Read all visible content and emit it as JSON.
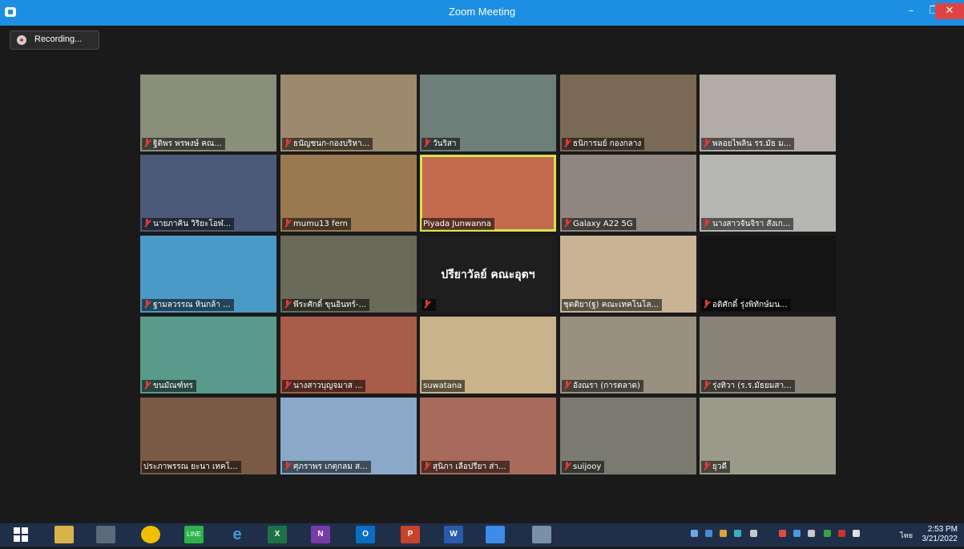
{
  "window": {
    "title": "Zoom Meeting",
    "minimize": "–",
    "restore": "❐",
    "close": "✕"
  },
  "recording": {
    "label": "Recording..."
  },
  "participants": [
    {
      "name": "ฐิติพร พรพงษ์ คณ...",
      "muted": true,
      "color": "#8a8f7a"
    },
    {
      "name": "ธนัญชนก-กองบริหา...",
      "muted": true,
      "color": "#9d8a6c"
    },
    {
      "name": "วันริสา",
      "muted": true,
      "color": "#6d7f78"
    },
    {
      "name": "ธนิการมย์ กองกลาง",
      "muted": true,
      "color": "#7a6a55"
    },
    {
      "name": "พลอยไพลิน รร.มัธ ม...",
      "muted": true,
      "color": "#b2aca8"
    },
    {
      "name": "นายภาคิน วิริยะโอฬ...",
      "muted": true,
      "color": "#4a5a78"
    },
    {
      "name": "mumu13 fern",
      "muted": true,
      "color": "#9a7850"
    },
    {
      "name": "Piyada Junwanna",
      "muted": false,
      "color": "#c46a4e",
      "active": true
    },
    {
      "name": "Galaxy A22 5G",
      "muted": true,
      "color": "#8f8680"
    },
    {
      "name": "นางสาวจันจิรา สังเก...",
      "muted": true,
      "color": "#b5b5b2"
    },
    {
      "name": "ฐามลวรรณ หินกล้า ...",
      "muted": true,
      "color": "#4a9ac8"
    },
    {
      "name": "พีระศักดิ์ ขุนอินทร์-...",
      "muted": true,
      "color": "#6a6a5a"
    },
    {
      "name": "",
      "display_name": "ปรียาวัลย์ คณะอุตฯ",
      "muted": true,
      "color": "#1e1e1e"
    },
    {
      "name": "ชุตติยา(ฐ) คณะเทคโนโล...",
      "muted": false,
      "color": "#c9b394"
    },
    {
      "name": "อดิศักดิ์ รุ่งพิทักษ์มน...",
      "muted": true,
      "color": "#141414"
    },
    {
      "name": "ขนมัณฑ์ทร",
      "muted": true,
      "color": "#5a9a8a"
    },
    {
      "name": "นางสาวบุญจมาส ...",
      "muted": true,
      "color": "#a85c4a"
    },
    {
      "name": "suwatana",
      "muted": false,
      "color": "#c9b38a"
    },
    {
      "name": "อังณรา (การตลาด)",
      "muted": true,
      "color": "#9a9080"
    },
    {
      "name": "รุ่งทิวา (ร.ร.มัธยมสา...",
      "muted": true,
      "color": "#8a8378"
    },
    {
      "name": "ประภาพรรณ ยะนา เทคโ...",
      "muted": false,
      "color": "#7a5a45"
    },
    {
      "name": "ศุภราพร เกตุกลม ส...",
      "muted": true,
      "color": "#8aa8c8"
    },
    {
      "name": "สุนิภา เลือปรียา ส่า...",
      "muted": true,
      "color": "#a86a5a"
    },
    {
      "name": "suijooy",
      "muted": true,
      "color": "#7a7a70"
    },
    {
      "name": "ยุวดี",
      "muted": true,
      "color": "#9a9a8a"
    }
  ],
  "taskbar": {
    "time": "2:53 PM",
    "date": "3/21/2022",
    "language": "ไทย"
  },
  "colors": {
    "titlebar": "#1c8fe3",
    "background": "#1a1a1a",
    "active_speaker": "#d7e34f",
    "muted": "#e53935",
    "taskbar": "#1f2f4a"
  }
}
